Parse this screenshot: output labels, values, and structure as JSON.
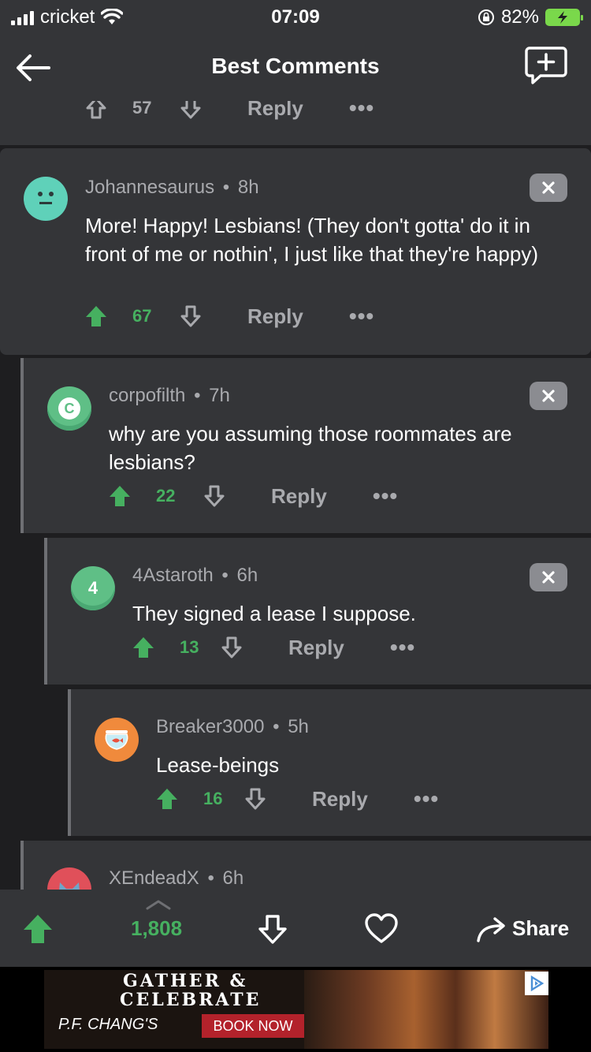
{
  "status_bar": {
    "carrier": "cricket",
    "time": "07:09",
    "battery": "82%"
  },
  "nav": {
    "title": "Best Comments"
  },
  "prev_comment": {
    "score": "57",
    "reply": "Reply",
    "more": "•••"
  },
  "comments": [
    {
      "author": "Johannesaurus",
      "age": "8h",
      "text": "More! Happy! Lesbians! (They don't gotta' do it in front of me or nothin', I just like that they're happy)",
      "score": "67",
      "reply": "Reply",
      "more": "•••",
      "avatar_letter": ""
    },
    {
      "author": "corpofilth",
      "age": "7h",
      "text": "why are you assuming those roommates are lesbians?",
      "score": "22",
      "reply": "Reply",
      "more": "•••",
      "avatar_letter": "C"
    },
    {
      "author": "4Astaroth",
      "age": "6h",
      "text": "They signed a lease I suppose.",
      "score": "13",
      "reply": "Reply",
      "more": "•••",
      "avatar_letter": "4"
    },
    {
      "author": "Breaker3000",
      "age": "5h",
      "text": "Lease-beings",
      "score": "16",
      "reply": "Reply",
      "more": "•••",
      "avatar_letter": ""
    },
    {
      "author": "XEndeadX",
      "age": "6h"
    }
  ],
  "bottom_bar": {
    "score": "1,808",
    "share": "Share"
  },
  "ad": {
    "headline_1": "GATHER &",
    "headline_2": "CELEBRATE",
    "brand": "P.F. CHANG'S",
    "cta": "BOOK NOW"
  },
  "colors": {
    "upvote": "#46b060",
    "card": "#343538",
    "background": "#1e1e20",
    "muted": "#a9aaae"
  },
  "separator": "•"
}
